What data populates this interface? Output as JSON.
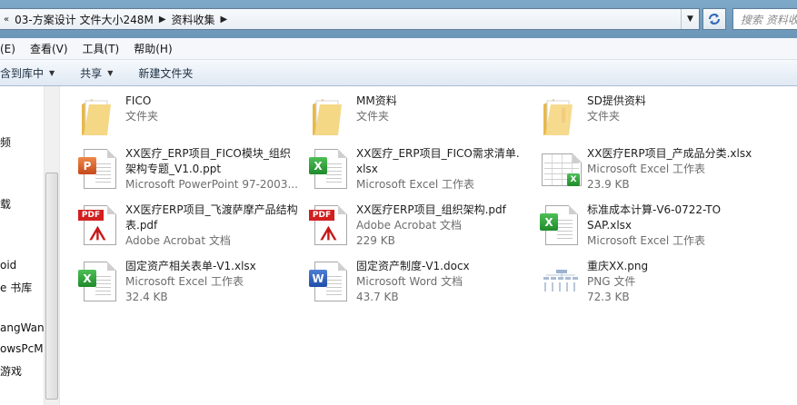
{
  "address": {
    "crumbs": [
      "03-方案设计 文件大小248M",
      "资料收集"
    ],
    "search_placeholder": "搜索 资料收集"
  },
  "menu": {
    "partial_first": "(E)",
    "view": "查看(V)",
    "tools": "工具(T)",
    "help": "帮助(H)"
  },
  "toolbar": {
    "include_library": "含到库中",
    "share": "共享",
    "new_folder": "新建文件夹"
  },
  "nav": {
    "items": [
      "频",
      "载",
      "oid",
      "e 书库",
      "angWang",
      "owsPcMa",
      "游戏"
    ]
  },
  "files": [
    {
      "name1": "FICO",
      "name2": "",
      "meta1": "文件夹",
      "meta2": "",
      "icon": "folder"
    },
    {
      "name1": "MM资料",
      "name2": "",
      "meta1": "文件夹",
      "meta2": "",
      "icon": "folder"
    },
    {
      "name1": "SD提供资料",
      "name2": "",
      "meta1": "文件夹",
      "meta2": "",
      "icon": "folder-red"
    },
    {
      "name1": "XX医疗_ERP项目_FICO模块_组织",
      "name2": "架构专题_V1.0.ppt",
      "meta1": "Microsoft PowerPoint 97-2003...",
      "meta2": "",
      "icon": "ppt"
    },
    {
      "name1": "XX医疗_ERP项目_FICO需求清单.",
      "name2": "xlsx",
      "meta1": "Microsoft Excel 工作表",
      "meta2": "",
      "icon": "xlsx"
    },
    {
      "name1": "XX医疗ERP项目_产成品分类.xlsx",
      "name2": "",
      "meta1": "Microsoft Excel 工作表",
      "meta2": "23.9 KB",
      "icon": "xlsx-sheet"
    },
    {
      "name1": "XX医疗ERP项目_飞渡萨摩产品结构",
      "name2": "表.pdf",
      "meta1": "Adobe Acrobat 文档",
      "meta2": "",
      "icon": "pdf"
    },
    {
      "name1": "XX医疗ERP项目_组织架构.pdf",
      "name2": "",
      "meta1": "Adobe Acrobat 文档",
      "meta2": "229 KB",
      "icon": "pdf"
    },
    {
      "name1": "标准成本计算-V6-0722-TO",
      "name2": "SAP.xlsx",
      "meta1": "Microsoft Excel 工作表",
      "meta2": "",
      "icon": "xlsx"
    },
    {
      "name1": "固定资产相关表单-V1.xlsx",
      "name2": "",
      "meta1": "Microsoft Excel 工作表",
      "meta2": "32.4 KB",
      "icon": "xlsx"
    },
    {
      "name1": "固定资产制度-V1.docx",
      "name2": "",
      "meta1": "Microsoft Word 文档",
      "meta2": "43.7 KB",
      "icon": "docx"
    },
    {
      "name1": "重庆XX.png",
      "name2": "",
      "meta1": "PNG 文件",
      "meta2": "72.3 KB",
      "icon": "png"
    }
  ],
  "colors": {
    "address_bg": "#7fa9c9",
    "meta_text": "#6d6d6d",
    "folder": "#f2d17a",
    "excel": "#1f8a2b",
    "word": "#1f4ea6",
    "pdf": "#d21f1f",
    "ppt": "#c4491a"
  }
}
